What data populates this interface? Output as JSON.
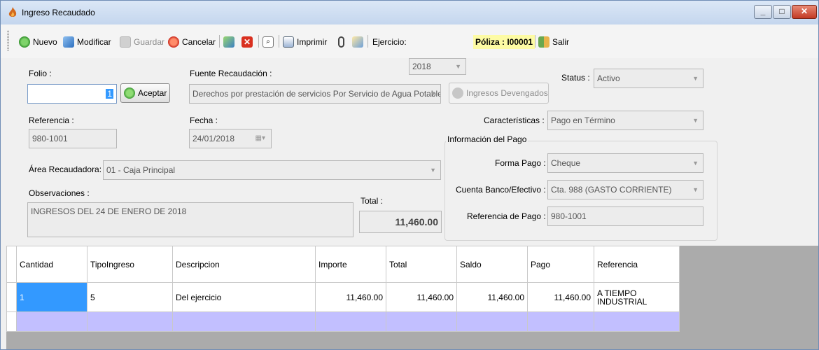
{
  "window": {
    "title": "Ingreso Recaudado"
  },
  "toolbar": {
    "nuevo": "Nuevo",
    "modificar": "Modificar",
    "guardar": "Guardar",
    "cancelar": "Cancelar",
    "imprimir": "Imprimir",
    "ejercicio_label": "Ejercicio:",
    "ejercicio_value": "2018",
    "poliza": "Póliza : I00001",
    "salir": "Salir"
  },
  "form": {
    "folio_label": "Folio :",
    "folio_value": "1",
    "aceptar": "Aceptar",
    "fuente_label": "Fuente Recaudación :",
    "fuente_value": "Derechos por prestación de servicios Por Servicio de Agua Potable, A",
    "ingresos_devengados": "Ingresos Devengados",
    "status_label": "Status :",
    "status_value": "Activo",
    "referencia_label": "Referencia :",
    "referencia_value": "980-1001",
    "fecha_label": "Fecha :",
    "fecha_value": "24/01/2018",
    "caracteristicas_label": "Características :",
    "caracteristicas_value": "Pago en Término",
    "area_label": "Área Recaudadora:",
    "area_value": "01 - Caja Principal",
    "observaciones_label": "Observaciones :",
    "observaciones_value": "INGRESOS DEL 24 DE ENERO DE 2018",
    "total_label": "Total :",
    "total_value": "11,460.00"
  },
  "pago": {
    "group_title": "Información del Pago",
    "forma_label": "Forma Pago :",
    "forma_value": "Cheque",
    "cuenta_label": "Cuenta Banco/Efectivo :",
    "cuenta_value": "Cta. 988 (GASTO CORRIENTE)",
    "ref_label": "Referencia de Pago :",
    "ref_value": "980-1001"
  },
  "grid": {
    "columns": [
      "Cantidad",
      "TipoIngreso",
      "Descripcion",
      "Importe",
      "Total",
      "Saldo",
      "Pago",
      "Referencia"
    ],
    "rows": [
      {
        "cantidad": "1",
        "tipo": "5",
        "descripcion": "Del ejercicio",
        "importe": "11,460.00",
        "total": "11,460.00",
        "saldo": "11,460.00",
        "pago": "11,460.00",
        "referencia": "A TIEMPO INDUSTRIAL"
      }
    ]
  },
  "colors": {
    "titlebar": "#c4d6ee",
    "selection": "#3399ff",
    "new_row": "#c2bfff",
    "grid_background": "#ababab"
  }
}
